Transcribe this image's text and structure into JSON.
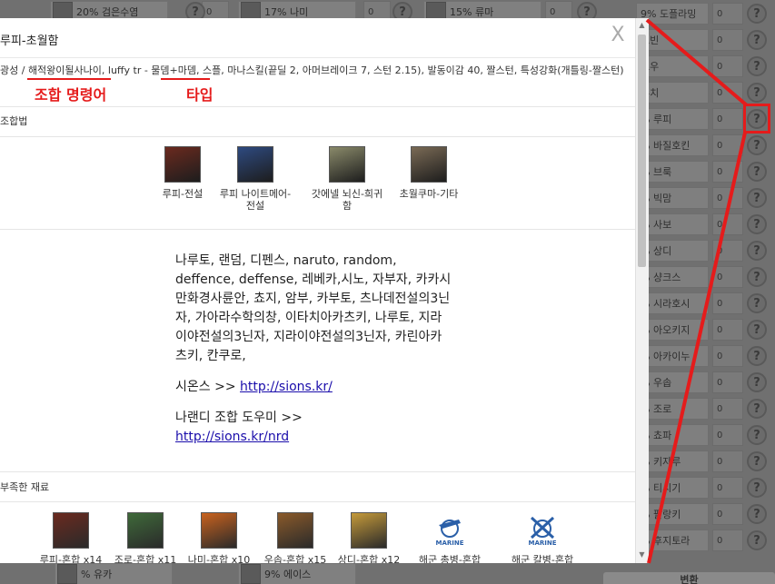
{
  "background": {
    "top_row": [
      {
        "label": "20% 검은수염",
        "count": "0"
      },
      {
        "label": "17% 나미",
        "count": "0"
      },
      {
        "label": "15% 류마",
        "count": "0"
      }
    ],
    "right_column": [
      {
        "label": "9% 도플라밍",
        "count": "0"
      },
      {
        "label": "로빈",
        "count": "0"
      },
      {
        "label": "로우",
        "count": "0"
      },
      {
        "label": "루치",
        "count": "0"
      },
      {
        "label": "% 루피",
        "count": "0"
      },
      {
        "label": "% 바질호킨",
        "count": "0"
      },
      {
        "label": "% 브룩",
        "count": "0"
      },
      {
        "label": "% 빅맘",
        "count": "0"
      },
      {
        "label": "% 사보",
        "count": "0"
      },
      {
        "label": "% 상디",
        "count": "0"
      },
      {
        "label": "% 샹크스",
        "count": "0"
      },
      {
        "label": "% 시라호시",
        "count": "0"
      },
      {
        "label": "% 아오키지",
        "count": "0"
      },
      {
        "label": "% 아카이누",
        "count": "0"
      },
      {
        "label": "% 우솝",
        "count": "0"
      },
      {
        "label": "% 조로",
        "count": "0"
      },
      {
        "label": "% 쵸파",
        "count": "0"
      },
      {
        "label": "% 키자루",
        "count": "0"
      },
      {
        "label": "% 티시기",
        "count": "0"
      },
      {
        "label": "% 팔랑키",
        "count": "0"
      },
      {
        "label": "% 후지토라",
        "count": "0"
      }
    ],
    "bottom_row": [
      {
        "label": "% 유카",
        "count": ""
      },
      {
        "label": "9% 에이스",
        "count": ""
      }
    ],
    "bottom_button": "변환"
  },
  "modal": {
    "title": "루피-초월함",
    "close_label": "X",
    "meta_line": "광성 / 해적왕이될사나이, luffy tr - 물뎀+마뎀, 스플, 마나스킬(끝딜 2, 아머브레이크 7, 스턴 2.15), 발동이감 40, 짤스턴, 특성강화(개틀링-짤스턴)",
    "recipe_label": "조합법",
    "recipe_items": [
      {
        "name": "루피-전설",
        "color": "#6b2a1f"
      },
      {
        "name": "루피 나이트메어-전설",
        "color": "#2e4a80"
      },
      {
        "name": "갓에넬 뇌신-희귀함",
        "color": "#8a8a6a"
      },
      {
        "name": "초월쿠마-기타",
        "color": "#7a6a55"
      }
    ],
    "description": {
      "keywords": "나루토, 랜덤, 디펜스, naruto, random, deffence, deffense, 레베카,시노, 자부자, 카카시만화경사륜안, 쵸지, 암부, 카부토, 츠나데전설의3닌자, 가아라수학의창, 이타치아카츠키, 나루토, 지라이야전설의3닌자, 지라이야전설의3닌자, 카린아카츠키, 칸쿠로,",
      "sions_label": "시온스 >> ",
      "sions_link": "http://sions.kr/",
      "helper_label": "나랜디 조합 도우미 >>",
      "helper_link": "http://sions.kr/nrd"
    },
    "missing_label": "부족한 재료",
    "materials": [
      {
        "name": "루피-혼합 x14",
        "color": "#6b2a1f",
        "kind": "portrait"
      },
      {
        "name": "조로-혼합 x11",
        "color": "#3f6a3a",
        "kind": "portrait"
      },
      {
        "name": "나미-혼합 x10",
        "color": "#c9621e",
        "kind": "portrait"
      },
      {
        "name": "우솝-혼합 x15",
        "color": "#8a5a2a",
        "kind": "portrait"
      },
      {
        "name": "상디-혼합 x12",
        "color": "#c59a3a",
        "kind": "portrait"
      },
      {
        "name": "해군 총병-혼합",
        "color": "#2a5fa8",
        "kind": "marine"
      },
      {
        "name": "해군 칼병-혼합",
        "color": "#2a5fa8",
        "kind": "marine"
      }
    ],
    "marine_text": "MARINE"
  },
  "annotations": {
    "command_label": "조합 명령어",
    "type_label": "타입",
    "color": "#e51b1b"
  }
}
